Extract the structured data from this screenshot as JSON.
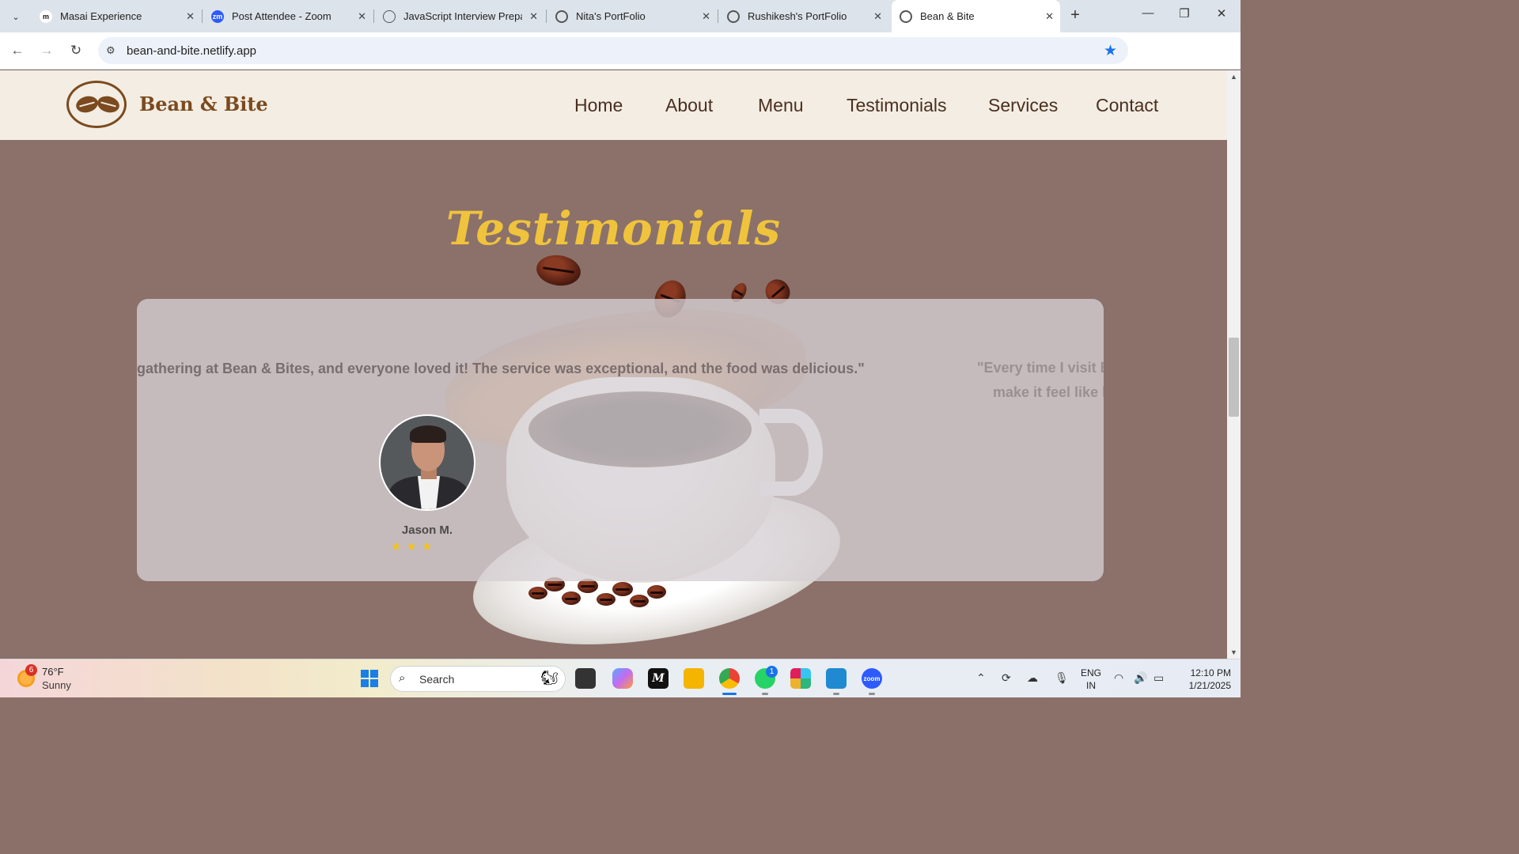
{
  "browser": {
    "tabs": [
      {
        "title": "Masai Experience",
        "favicon": "M",
        "favicon_color": "#ffffff",
        "favicon_fg": "#111111"
      },
      {
        "title": "Post Attendee - Zoom",
        "favicon": "zm",
        "favicon_color": "#2d5bff",
        "favicon_fg": "#ffffff"
      },
      {
        "title": "JavaScript Interview Prepar",
        "favicon": "◎",
        "favicon_color": "#dde3ea",
        "favicon_fg": "#333333"
      },
      {
        "title": "Nita's PortFolio",
        "favicon": "🌐",
        "favicon_color": "#dde3ea",
        "favicon_fg": "#555555"
      },
      {
        "title": "Rushikesh's PortFolio",
        "favicon": "🌐",
        "favicon_color": "#dde3ea",
        "favicon_fg": "#555555"
      },
      {
        "title": "Bean & Bite",
        "favicon": "🌐",
        "favicon_color": "#ffffff",
        "favicon_fg": "#555555",
        "active": true
      }
    ],
    "close_glyph": "✕",
    "new_tab_glyph": "+",
    "url": "bean-and-bite.netlify.app",
    "window_controls": {
      "minimize": "—",
      "restore": "❐",
      "close": "✕"
    }
  },
  "site": {
    "logo_text": "Bean & Bite",
    "nav": [
      "Home",
      "About",
      "Menu",
      "Testimonials",
      "Services",
      "Contact"
    ],
    "section_title": "Testimonials",
    "testimonial": {
      "quote_visible": "gathering at Bean & Bites, and everyone loved it! The service was exceptional, and the food was delicious.\"",
      "author": "Jason M.",
      "stars": "★★★",
      "rating": 3
    },
    "next_quote": {
      "line1": "\"Every time I visit B",
      "line2": "make it feel like h"
    },
    "colors": {
      "accent": "#f0c33c",
      "brand": "#7b4a1e",
      "background": "#8b716a"
    }
  },
  "taskbar": {
    "weather": {
      "temp": "76°F",
      "condition": "Sunny",
      "badge": "6"
    },
    "search_label": "Search",
    "apps": [
      "windows-start",
      "file-manager",
      "copilot",
      "masai",
      "files",
      "chrome",
      "whatsapp",
      "slack",
      "vscode",
      "zoom"
    ],
    "whatsapp_badge": "1",
    "language": {
      "line1": "ENG",
      "line2": "IN"
    },
    "time": "12:10 PM",
    "date": "1/21/2025"
  }
}
